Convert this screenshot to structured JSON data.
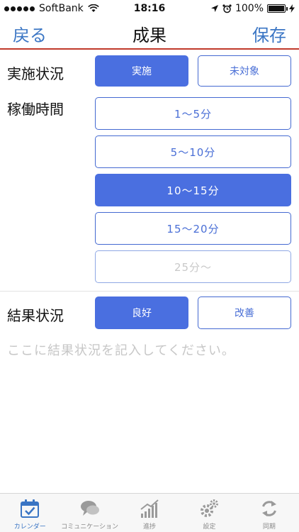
{
  "status_bar": {
    "carrier": "SoftBank",
    "time": "18:16",
    "battery_percent": "100%",
    "battery_level": 1.0
  },
  "nav": {
    "back_label": "戻る",
    "title": "成果",
    "save_label": "保存"
  },
  "implementation": {
    "label": "実施状況",
    "options": [
      {
        "label": "実施",
        "selected": true
      },
      {
        "label": "未対象",
        "selected": false
      }
    ]
  },
  "operating_time": {
    "label": "稼働時間",
    "options": [
      {
        "label": "1～5分",
        "selected": false,
        "disabled": false
      },
      {
        "label": "5～10分",
        "selected": false,
        "disabled": false
      },
      {
        "label": "10～15分",
        "selected": true,
        "disabled": false
      },
      {
        "label": "15～20分",
        "selected": false,
        "disabled": false
      },
      {
        "label": "25分～",
        "selected": false,
        "disabled": true
      }
    ]
  },
  "result": {
    "label": "結果状況",
    "options": [
      {
        "label": "良好",
        "selected": true
      },
      {
        "label": "改善",
        "selected": false
      }
    ],
    "placeholder": "ここに結果状況を記入してください。"
  },
  "tab_bar": {
    "items": [
      {
        "label": "カレンダー",
        "icon": "calendar-icon",
        "active": true
      },
      {
        "label": "コミュニケーション",
        "icon": "chat-bubbles-icon",
        "active": false
      },
      {
        "label": "進捗",
        "icon": "chart-icon",
        "active": false
      },
      {
        "label": "設定",
        "icon": "gear-icon",
        "active": false
      },
      {
        "label": "同期",
        "icon": "sync-icon",
        "active": false
      }
    ]
  },
  "colors": {
    "accent": "#3a75c4",
    "selected_fill": "#4a6fe0",
    "nav_divider": "#c0392b"
  }
}
